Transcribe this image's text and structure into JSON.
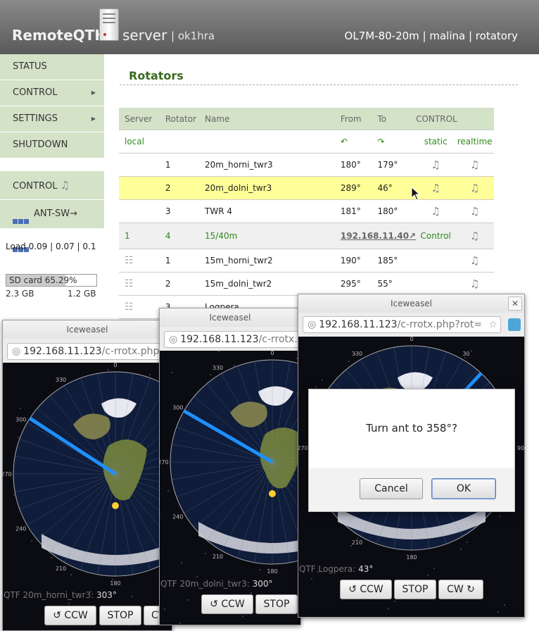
{
  "header": {
    "logo": "RemoteQTH",
    "server_word": "server",
    "callsign": "| ok1hra",
    "right_info": "OL7M-80-20m | malina | rotatory"
  },
  "sidebar": {
    "menu": [
      {
        "label": "STATUS",
        "has_submenu": false
      },
      {
        "label": "CONTROL",
        "has_submenu": true
      },
      {
        "label": "SETTINGS",
        "has_submenu": true
      },
      {
        "label": "SHUTDOWN",
        "has_submenu": false
      }
    ],
    "quick": [
      {
        "label": "CONTROL",
        "icon": "rotator-control-icon"
      },
      {
        "label": "ANT-SW→",
        "icon": "grid-icon"
      }
    ],
    "load": "Load 0.09 | 0.07 | 0.1",
    "sd_card": {
      "label": "SD card 65.29%",
      "percent": 65.29,
      "used": "2.3 GB",
      "free": "1.2 GB"
    }
  },
  "main": {
    "title": "Rotators",
    "columns": [
      "Server",
      "Rotator",
      "Name",
      "From",
      "To",
      "CONTROL"
    ],
    "local_row": {
      "server": "local",
      "from": "↶",
      "to": "↷",
      "static": "static",
      "realtime": "realtime"
    },
    "local_rotators": [
      {
        "rotator": "1",
        "name": "20m_horni_twr3",
        "from": "180°",
        "to": "179°"
      },
      {
        "rotator": "2",
        "name": "20m_dolni_twr3",
        "from": "289°",
        "to": "46°"
      },
      {
        "rotator": "3",
        "name": "TWR 4",
        "from": "181°",
        "to": "180°"
      }
    ],
    "remote_row": {
      "server": "1",
      "rotator": "4",
      "name": "15/40m",
      "ip": "192.168.11.40↗",
      "control": "Control"
    },
    "remote_rotators": [
      {
        "rotator": "1",
        "name": "15m_horni_twr2",
        "from": "190°",
        "to": "185°"
      },
      {
        "rotator": "2",
        "name": "15m_dolni_twr2",
        "from": "295°",
        "to": "55°"
      },
      {
        "rotator": "3",
        "name": "Logpera",
        "from": "",
        "to": ""
      }
    ]
  },
  "windows": [
    {
      "title": "Iceweasel",
      "url_host": "192.168.11.123",
      "url_path": "/c-rrotx.php",
      "qtf_label": "QTF 20m_horni_twr3:",
      "qtf_value": "303°",
      "heading": 303
    },
    {
      "title": "Iceweasel",
      "url_host": "192.168.11.123",
      "url_path": "/c-rrotx.",
      "qtf_label": "QTF 20m_dolni_twr3:",
      "qtf_value": "300°",
      "heading": 300
    },
    {
      "title": "Iceweasel",
      "url_host": "192.168.11.123",
      "url_path": "/c-rrotx.php?rot=",
      "qtf_label": "QTF Logpera:",
      "qtf_value": "43°",
      "heading": 43
    }
  ],
  "buttons": {
    "ccw": "↺ CCW",
    "stop": "STOP",
    "cw": "CW ↻",
    "cw_cut": "CV"
  },
  "compass_labels": [
    "0",
    "30",
    "300",
    "330",
    "270",
    "240",
    "210",
    "180",
    "90"
  ],
  "dialog": {
    "message": "Turn ant to 358°?",
    "cancel": "Cancel",
    "ok": "OK"
  },
  "icons": {
    "control": "♫",
    "globe": "◎",
    "star": "☆",
    "close": "✕",
    "network": "☷"
  }
}
